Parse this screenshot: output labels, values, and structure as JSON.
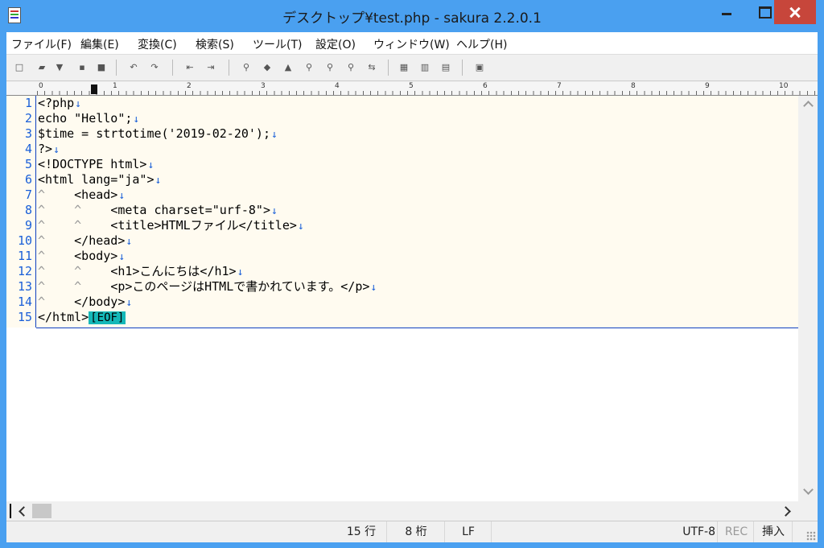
{
  "window": {
    "title": "デスクトップ¥test.php - sakura 2.2.0.1"
  },
  "menu": [
    "ファイル(F)",
    "編集(E)",
    "変換(C)",
    "検索(S)",
    "ツール(T)",
    "設定(O)",
    "ウィンドウ(W)",
    "ヘルプ(H)"
  ],
  "ruler": {
    "labels": [
      "0",
      "1",
      "2",
      "3",
      "4",
      "5",
      "6",
      "7",
      "8",
      "9",
      "10"
    ]
  },
  "editor": {
    "lines": [
      {
        "no": "1",
        "text": "<?php"
      },
      {
        "no": "2",
        "text": "echo \"Hello\";"
      },
      {
        "no": "3",
        "text": "$time = strtotime('2019-02-20');"
      },
      {
        "no": "4",
        "text": "?>"
      },
      {
        "no": "5",
        "text": "<!DOCTYPE html>"
      },
      {
        "no": "6",
        "text": "<html lang=\"ja\">"
      },
      {
        "no": "7",
        "text": "<head>"
      },
      {
        "no": "8",
        "text": "<meta charset=\"urf-8\">"
      },
      {
        "no": "9",
        "text": "<title>HTMLファイル</title>"
      },
      {
        "no": "10",
        "text": "</head>"
      },
      {
        "no": "11",
        "text": "<body>"
      },
      {
        "no": "12",
        "text": "<h1>こんにちは</h1>"
      },
      {
        "no": "13",
        "text": "<p>このページはHTMLで書かれています。</p>"
      },
      {
        "no": "14",
        "text": "</body>"
      },
      {
        "no": "15",
        "text": "</html>"
      }
    ],
    "lf_mark": "↓",
    "tab_mark": "^",
    "eof_label": "[EOF]"
  },
  "status": {
    "row": "15 行",
    "col": "8 桁",
    "eol": "LF",
    "encoding": "UTF-8",
    "rec": "REC",
    "mode": "挿入"
  }
}
